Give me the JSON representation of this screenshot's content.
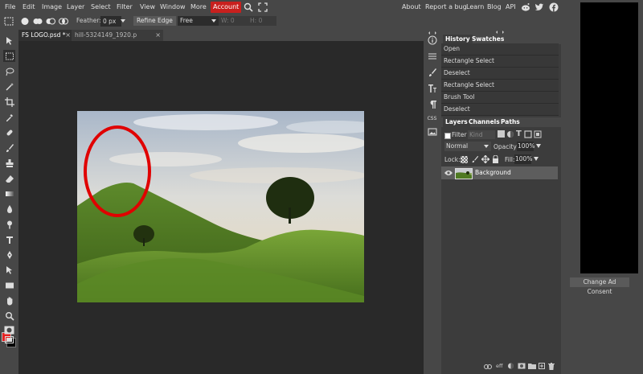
{
  "menu": {
    "items": [
      "File",
      "Edit",
      "Image",
      "Layer",
      "Select",
      "Filter",
      "View",
      "Window",
      "More",
      "Account"
    ],
    "right_links": [
      "About",
      "Report a bug",
      "Learn",
      "Blog",
      "API"
    ]
  },
  "options": {
    "feather_label": "Feather:",
    "feather_value": "0 px",
    "refine_edge": "Refine Edge",
    "style_value": "Free",
    "width_label": "W:",
    "width_value": "0",
    "height_label": "H:",
    "height_value": "0"
  },
  "tabs": [
    {
      "label": "FS LOGO.psd *"
    },
    {
      "label": "hill-5324149_1920.p"
    }
  ],
  "history": {
    "tabs": [
      "History",
      "Swatches"
    ],
    "items": [
      "Open",
      "Rectangle Select",
      "Deselect",
      "Rectangle Select",
      "Brush Tool",
      "Deselect"
    ]
  },
  "layers": {
    "tabs": [
      "Layers",
      "Channels",
      "Paths"
    ],
    "filter_label": "Filter",
    "kind_value": "Kind",
    "blend_mode": "Normal",
    "opacity_label": "Opacity:",
    "opacity_value": "100%",
    "lock_label": "Lock:",
    "fill_label": "Fill:",
    "fill_value": "100%",
    "layer_name": "Background",
    "footer_eff": "eff"
  },
  "ad": {
    "consent_button": "Change Ad Consent"
  },
  "colors": {
    "accent": "#c8201e",
    "foreground_swatch": "#e62020",
    "background_swatch": "#000000"
  }
}
